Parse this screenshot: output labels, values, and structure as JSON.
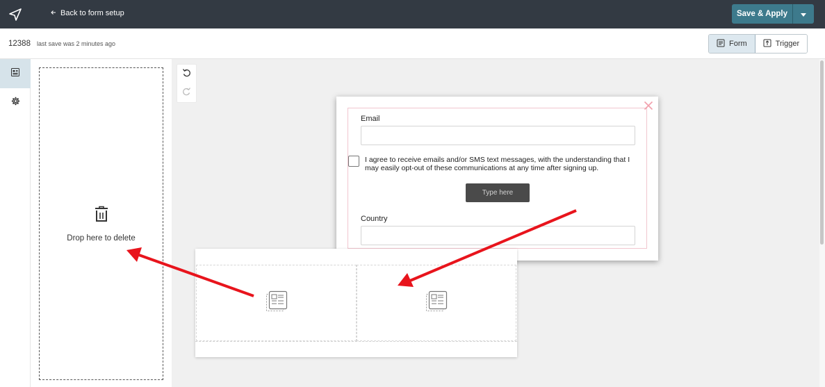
{
  "topbar": {
    "logo_icon": "paper-plane-icon",
    "back_label": "Back to form setup",
    "back_icon": "arrow-left-icon",
    "save_label": "Save & Apply",
    "save_caret_icon": "caret-down-icon"
  },
  "subbar": {
    "form_id": "12388",
    "save_status": "last save was 2 minutes ago",
    "toggles": [
      {
        "label": "Form",
        "icon": "form-icon",
        "active": true
      },
      {
        "label": "Trigger",
        "icon": "trigger-icon",
        "active": false
      }
    ]
  },
  "sidebar": {
    "items": [
      {
        "icon": "form-elements-icon",
        "active": true
      },
      {
        "icon": "gear-icon",
        "active": false
      }
    ]
  },
  "dropzone": {
    "icon": "trash-icon",
    "label": "Drop here to delete"
  },
  "history": {
    "undo_icon": "undo-icon",
    "redo_icon": "redo-icon"
  },
  "popup": {
    "close_icon": "close-icon",
    "email_label": "Email",
    "consent_text": "I agree to receive emails and/or SMS text messages, with the understanding that I may easily opt-out of these communications at any time after signing up.",
    "submit_label": "Type here",
    "country_label": "Country"
  },
  "row_block": {
    "column_icon": "block-placeholder-icon"
  },
  "annotations": {
    "arrow_color": "#e8141c"
  },
  "colors": {
    "topbar_bg": "#333a43",
    "accent": "#3d7a8c",
    "toggle_active_bg": "#dde8ef"
  }
}
